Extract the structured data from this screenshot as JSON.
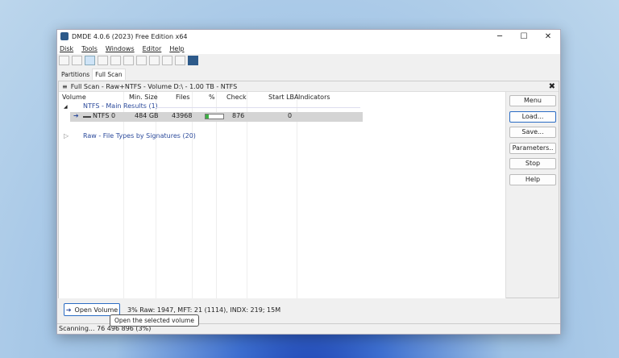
{
  "window": {
    "title": "DMDE 4.0.6 (2023) Free Edition x64",
    "minimize": "─",
    "maximize": "☐",
    "close": "✕"
  },
  "menu": [
    "Disk",
    "Tools",
    "Windows",
    "Editor",
    "Help"
  ],
  "tabs": [
    "Partitions",
    "Full Scan"
  ],
  "panel": {
    "title": "Full Scan - Raw+NTFS - Volume D:\\ - 1.00 TB - NTFS",
    "close": "✖"
  },
  "columns": [
    "Volume",
    "Min. Size",
    "Files",
    "%",
    "Check",
    "Start LBA",
    "Indicators"
  ],
  "groups": [
    {
      "label": "NTFS - Main Results (1)",
      "expanded": true
    },
    {
      "label": "Raw - File Types by Signatures (20)",
      "expanded": false
    }
  ],
  "rows": [
    {
      "volume": "NTFS 0",
      "min_size": "484 GB",
      "files": "43968",
      "percent": 20,
      "check": "876",
      "start_lba": "0"
    }
  ],
  "buttons": [
    "Menu",
    "Load...",
    "Save...",
    "Parameters..",
    "Stop",
    "Help"
  ],
  "open_volume": "Open Volume",
  "scan_status": "3% Raw: 1947, MFT: 21 (1114), INDX: 219; 15M",
  "tooltip": "Open the selected volume",
  "statusbar": "Scanning... 76 496 896 (3%)",
  "colors": {
    "accent": "#2b6cc4",
    "group_text": "#2b4a9b",
    "progress": "#3cb043"
  }
}
